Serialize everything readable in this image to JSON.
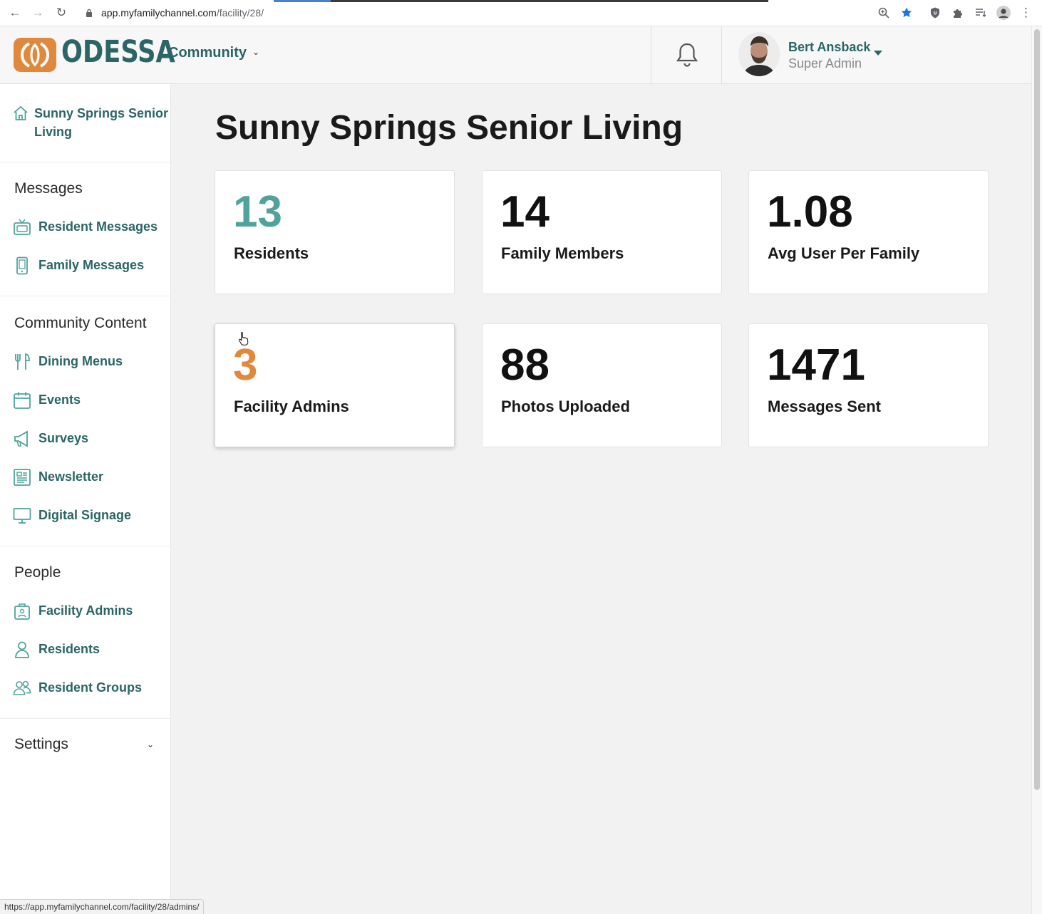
{
  "browser": {
    "url_host": "app.myfamilychannel.com",
    "url_path": "/facility/28/",
    "status_url": "https://app.myfamilychannel.com/facility/28/admins/"
  },
  "header": {
    "logo_text": "ODESSA",
    "community_label": "Community",
    "user_name": "Bert Ansback",
    "user_role": "Super Admin"
  },
  "sidebar": {
    "home_label": "Sunny Springs Senior Living",
    "sections": {
      "messages": "Messages",
      "content": "Community Content",
      "people": "People",
      "settings": "Settings"
    },
    "items": {
      "resident_messages": "Resident Messages",
      "family_messages": "Family Messages",
      "dining_menus": "Dining Menus",
      "events": "Events",
      "surveys": "Surveys",
      "newsletter": "Newsletter",
      "digital_signage": "Digital Signage",
      "facility_admins": "Facility Admins",
      "residents": "Residents",
      "resident_groups": "Resident Groups"
    }
  },
  "main": {
    "title": "Sunny Springs Senior Living",
    "stats": [
      {
        "value": "13",
        "label": "Residents",
        "color": "#4fa39b"
      },
      {
        "value": "14",
        "label": "Family Members",
        "color": "#111111"
      },
      {
        "value": "1.08",
        "label": "Avg User Per Family",
        "color": "#111111"
      },
      {
        "value": "3",
        "label": "Facility Admins",
        "color": "#e0883c"
      },
      {
        "value": "88",
        "label": "Photos Uploaded",
        "color": "#111111"
      },
      {
        "value": "1471",
        "label": "Messages Sent",
        "color": "#111111"
      }
    ]
  },
  "colors": {
    "brand_teal": "#2b6566",
    "brand_orange": "#e0883c",
    "accent_teal": "#4fa39b"
  }
}
